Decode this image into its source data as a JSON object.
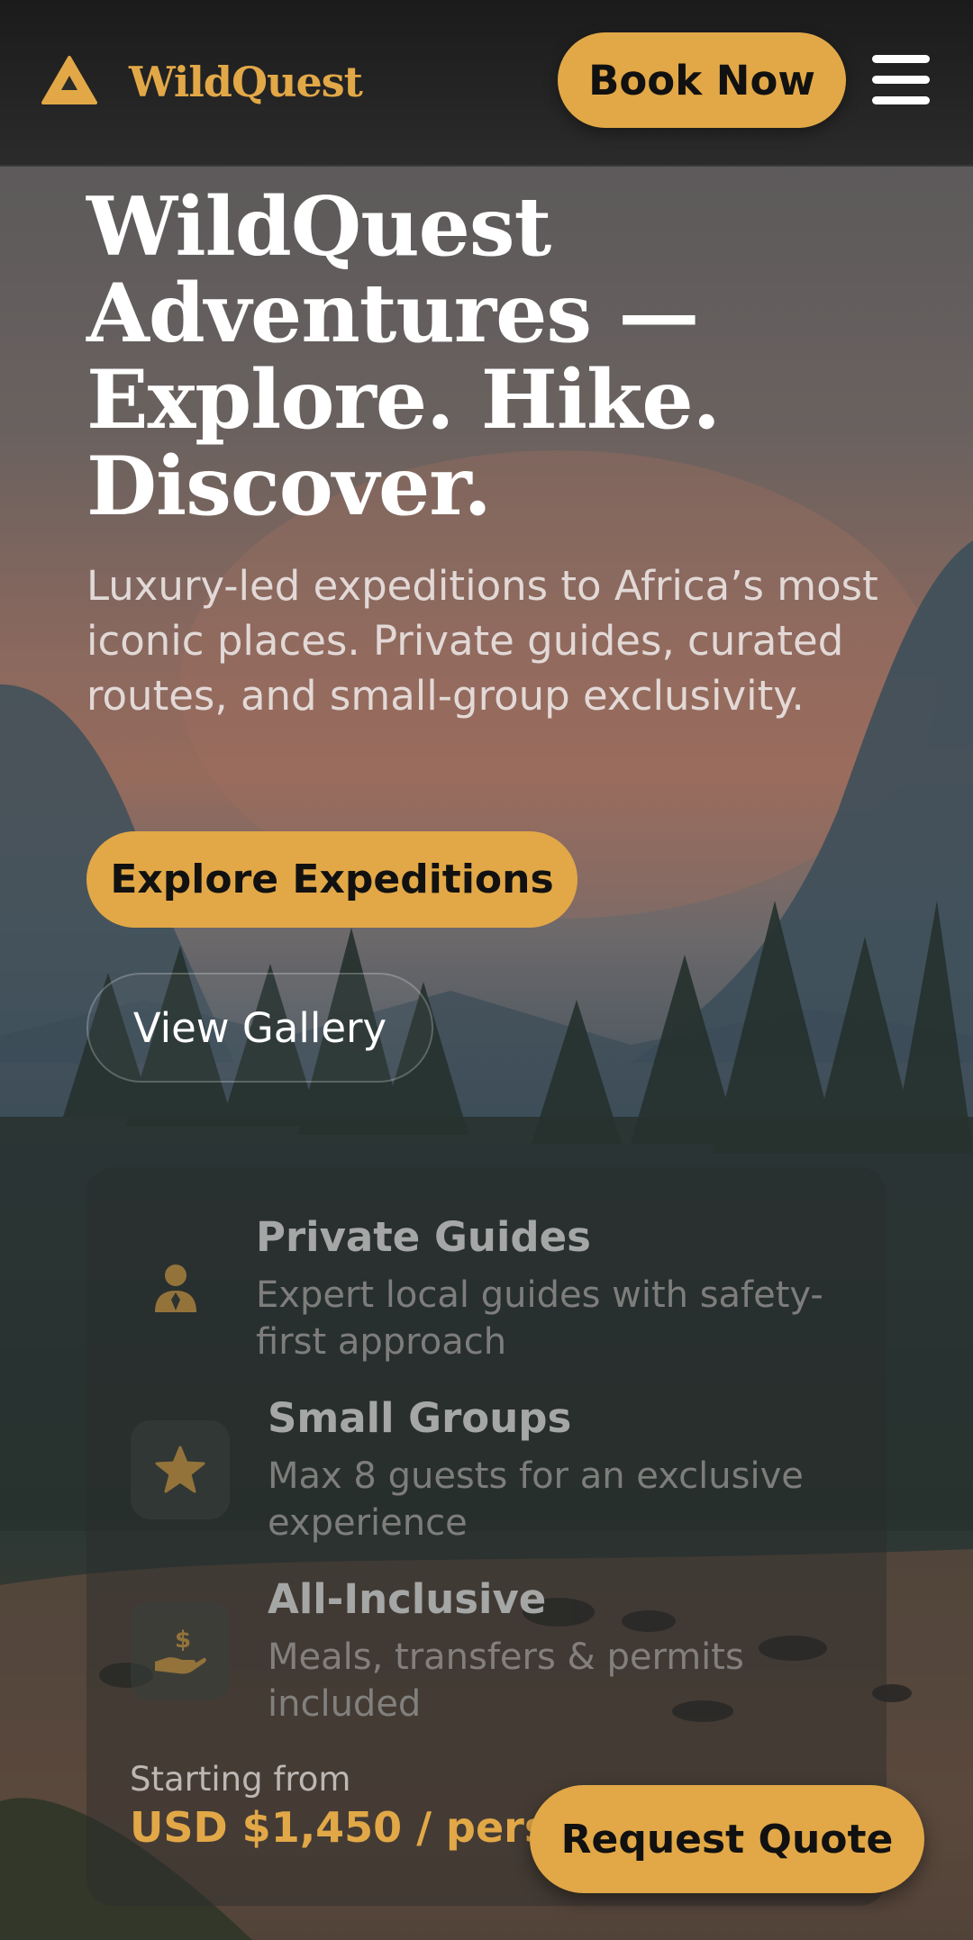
{
  "header": {
    "brand_name": "WildQuest",
    "logo_icon": "mountain-triangle-icon",
    "book_label": "Book Now",
    "menu_icon": "hamburger-menu-icon"
  },
  "hero": {
    "title": "WildQuest Adventures — Explore. Hike. Discover.",
    "subtitle": "Luxury-led expeditions to Africa’s most iconic places. Private guides, curated routes, and small-group exclusivity.",
    "primary_cta": "Explore Expeditions",
    "secondary_cta": "View Gallery"
  },
  "features": [
    {
      "icon": "guide-person-icon",
      "title": "Private Guides",
      "description": "Expert local guides with safety-first approach"
    },
    {
      "icon": "star-icon",
      "title": "Small Groups",
      "description": "Max 8 guests for an exclusive experience"
    },
    {
      "icon": "hand-dollar-icon",
      "title": "All-Inclusive",
      "description": "Meals, transfers & permits included"
    }
  ],
  "pricing": {
    "label": "Starting from",
    "value": "USD $1,450 / person"
  },
  "quote_button": "Request Quote",
  "colors": {
    "accent": "#e2a847",
    "header_bg": "#1b1b1b",
    "text_primary": "#ffffff"
  }
}
